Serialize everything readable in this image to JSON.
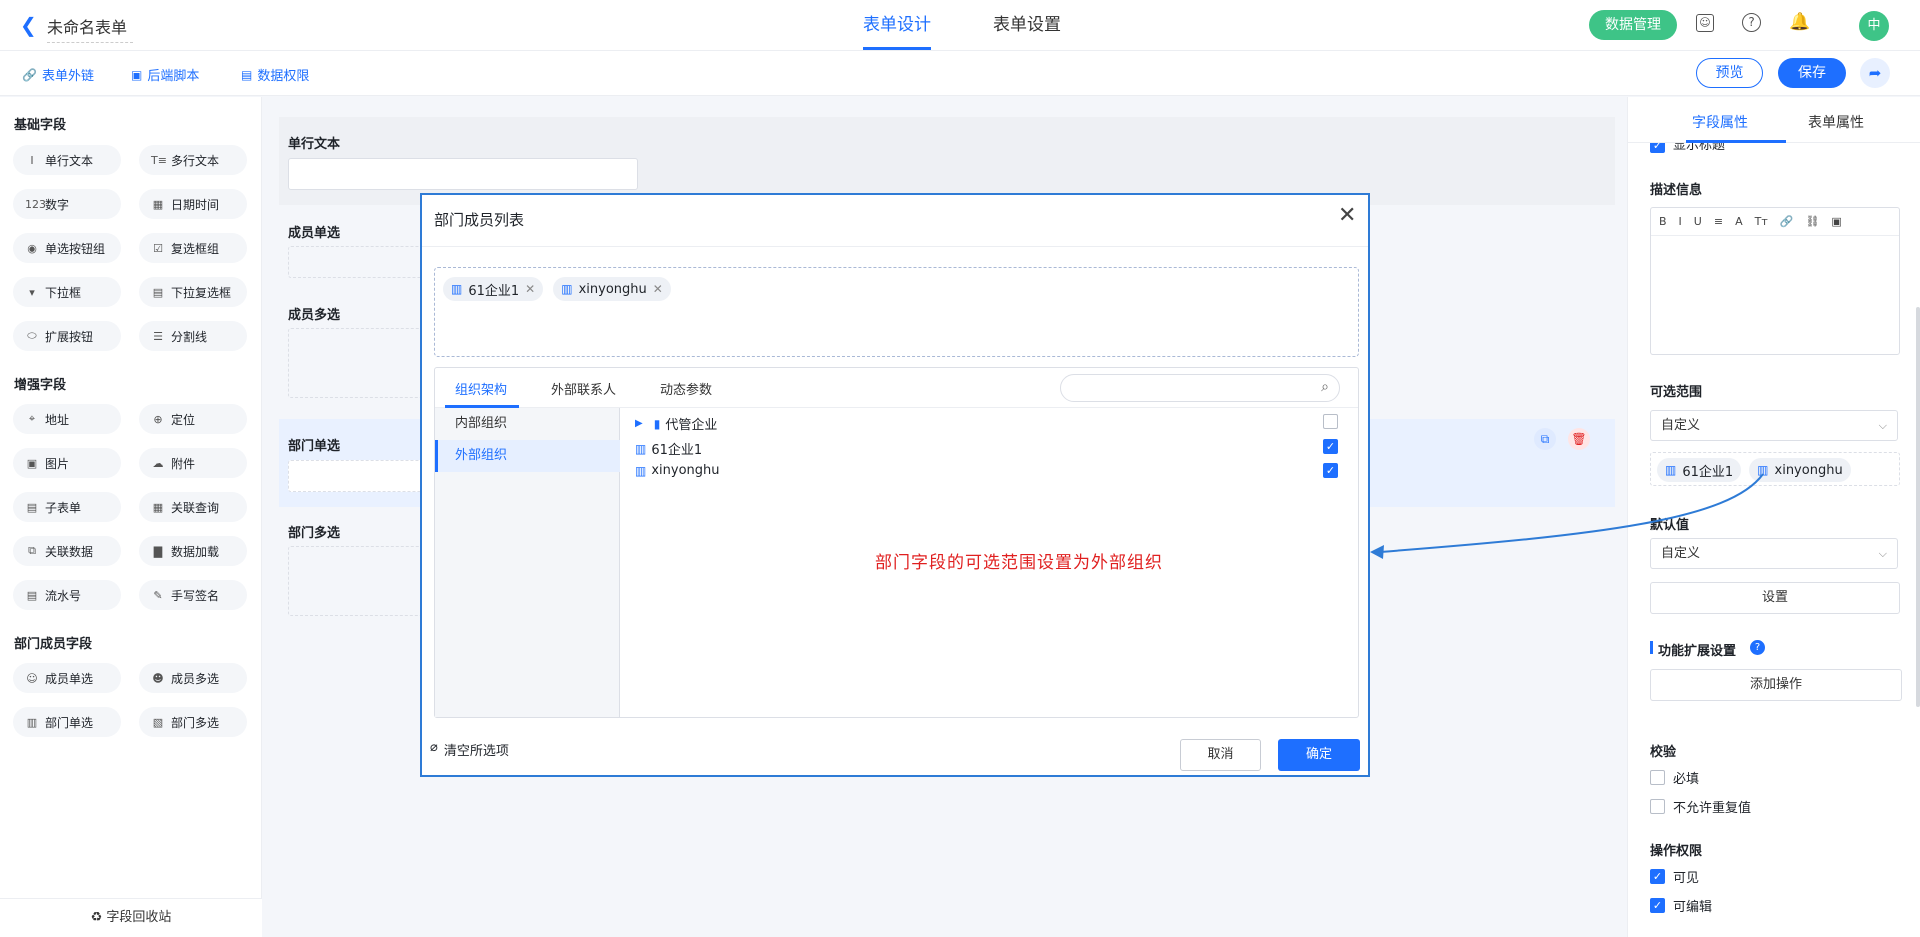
{
  "header": {
    "back_icon": "chevron-left-icon",
    "form_name": "未命名表单",
    "tabs": [
      {
        "label": "表单设计",
        "active": true
      },
      {
        "label": "表单设置",
        "active": false
      }
    ],
    "data_manage": "数据管理",
    "avatar_text": "中"
  },
  "toolbar": {
    "links": [
      "表单外链",
      "后端脚本",
      "数据权限"
    ],
    "preview": "预览",
    "save": "保存"
  },
  "left_panel": {
    "sections": [
      {
        "title": "基础字段",
        "items": [
          "单行文本",
          "多行文本",
          "数字",
          "日期时间",
          "单选按钮组",
          "复选框组",
          "下拉框",
          "下拉复选框",
          "扩展按钮",
          "分割线"
        ]
      },
      {
        "title": "增强字段",
        "items": [
          "地址",
          "定位",
          "图片",
          "附件",
          "子表单",
          "关联查询",
          "关联数据",
          "数据加载",
          "流水号",
          "手写签名"
        ]
      },
      {
        "title": "部门成员字段",
        "items": [
          "成员单选",
          "成员多选",
          "部门单选",
          "部门多选"
        ]
      }
    ],
    "recycle": "字段回收站"
  },
  "canvas": {
    "fields": [
      "单行文本",
      "成员单选",
      "成员多选",
      "部门单选",
      "部门多选"
    ]
  },
  "right_panel": {
    "tabs": [
      "字段属性",
      "表单属性"
    ],
    "partial_top": "显示标题",
    "desc_label": "描述信息",
    "editor_tools": [
      "B",
      "I",
      "U",
      "≡",
      "A",
      "Tт",
      "🔗",
      "⛓",
      "▣"
    ],
    "range_label": "可选范围",
    "range_value": "自定义",
    "range_tags": [
      "61企业1",
      "xinyonghu"
    ],
    "default_label": "默认值",
    "default_value": "自定义",
    "set_button": "设置",
    "ext_label": "功能扩展设置",
    "add_action": "添加操作",
    "validate_label": "校验",
    "required": "必填",
    "no_dup": "不允许重复值",
    "perm_label": "操作权限",
    "visible": "可见",
    "editable": "可编辑"
  },
  "modal": {
    "title": "部门成员列表",
    "selected": [
      "61企业1",
      "xinyonghu"
    ],
    "tabs": [
      "组织架构",
      "外部联系人",
      "动态参数"
    ],
    "left_items": [
      "内部组织",
      "外部组织"
    ],
    "rows": [
      {
        "label": "代管企业",
        "checked": false
      },
      {
        "label": "61企业1",
        "checked": true
      },
      {
        "label": "xinyonghu",
        "checked": true
      }
    ],
    "annotation": "部门字段的可选范围设置为外部组织",
    "clear": "清空所选项",
    "cancel": "取消",
    "ok": "确定"
  }
}
